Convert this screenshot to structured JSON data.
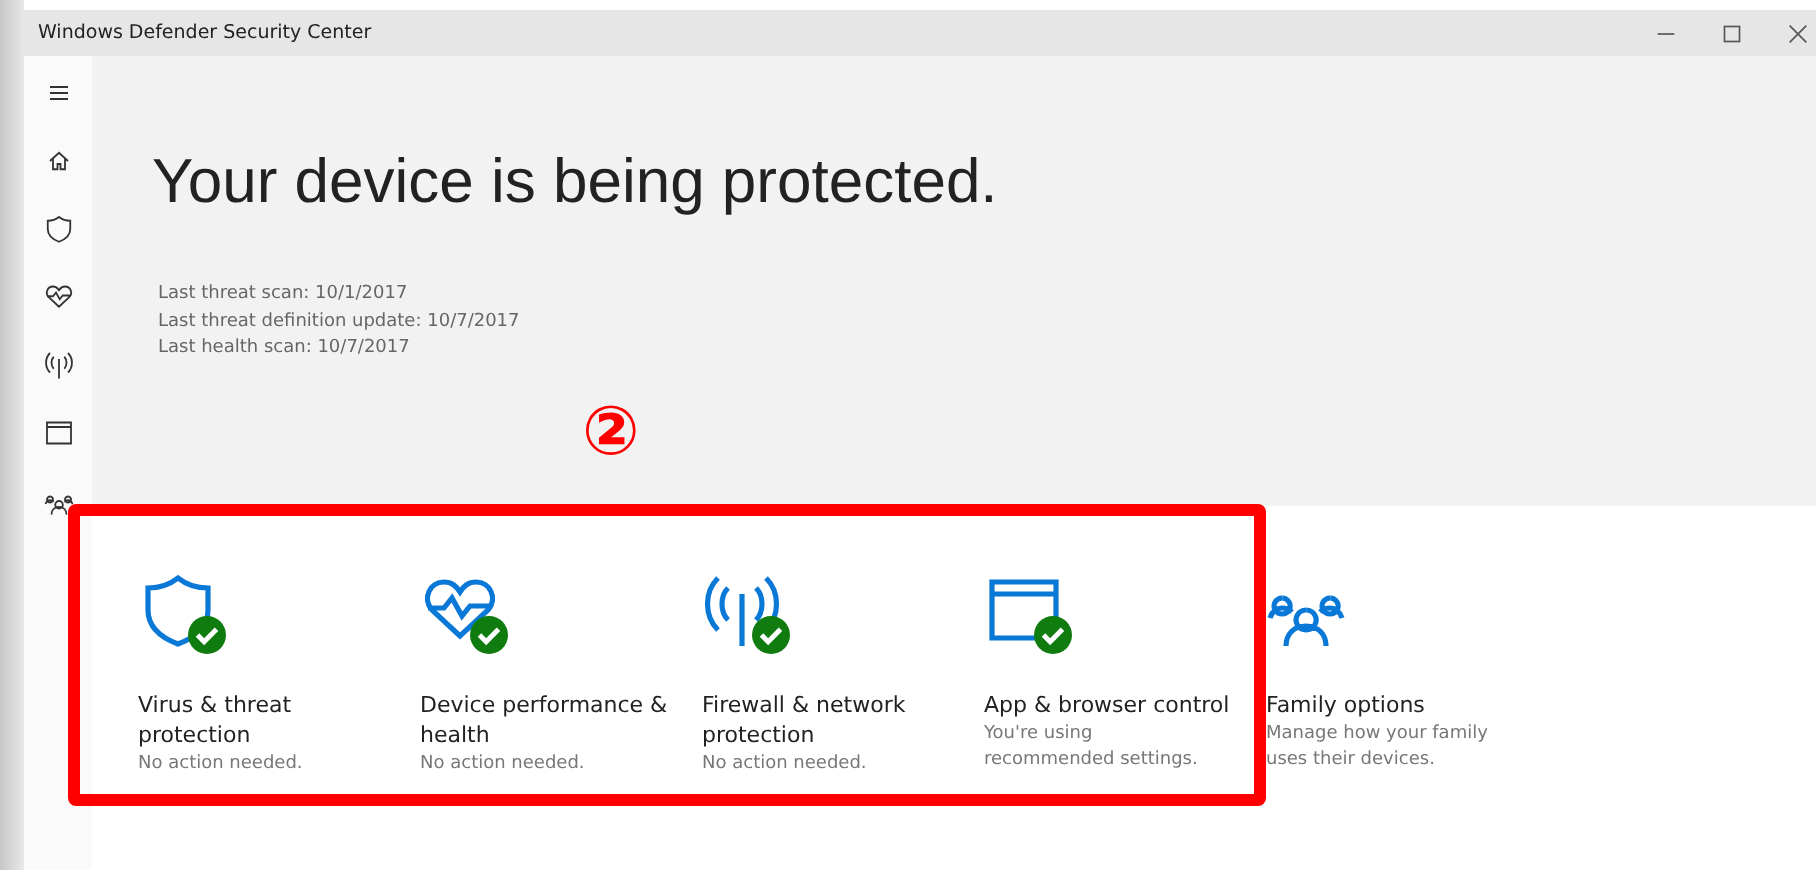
{
  "window": {
    "title": "Windows Defender Security Center",
    "controls": [
      {
        "kind": "minimize"
      },
      {
        "kind": "maximize"
      },
      {
        "kind": "close"
      }
    ]
  },
  "sidebar": {
    "items": [
      {
        "kind": "menu"
      },
      {
        "kind": "home"
      },
      {
        "kind": "shield"
      },
      {
        "kind": "heart"
      },
      {
        "kind": "antenna"
      },
      {
        "kind": "browser"
      },
      {
        "kind": "family"
      }
    ]
  },
  "heading": "Your device is being protected.",
  "scan_info": [
    "Last threat scan:  10/1/2017",
    "Last threat definition update:  10/7/2017",
    "Last health scan:  10/7/2017"
  ],
  "annotation": {
    "label": "②"
  },
  "tiles": [
    {
      "kind": "shield",
      "title": "Virus & threat protection",
      "status": "No action needed.",
      "ok": true,
      "highlighted": true
    },
    {
      "kind": "heart",
      "title": "Device performance & health",
      "status": "No action needed.",
      "ok": true,
      "highlighted": true
    },
    {
      "kind": "antenna",
      "title": "Firewall & network protection",
      "status": "No action needed.",
      "ok": true,
      "highlighted": true
    },
    {
      "kind": "browser",
      "title": "App & browser control",
      "status": "You're using recommended settings.",
      "ok": true,
      "highlighted": true
    },
    {
      "kind": "family",
      "title": "Family options",
      "status": "Manage how your family uses their devices.",
      "ok": false,
      "highlighted": false
    }
  ]
}
